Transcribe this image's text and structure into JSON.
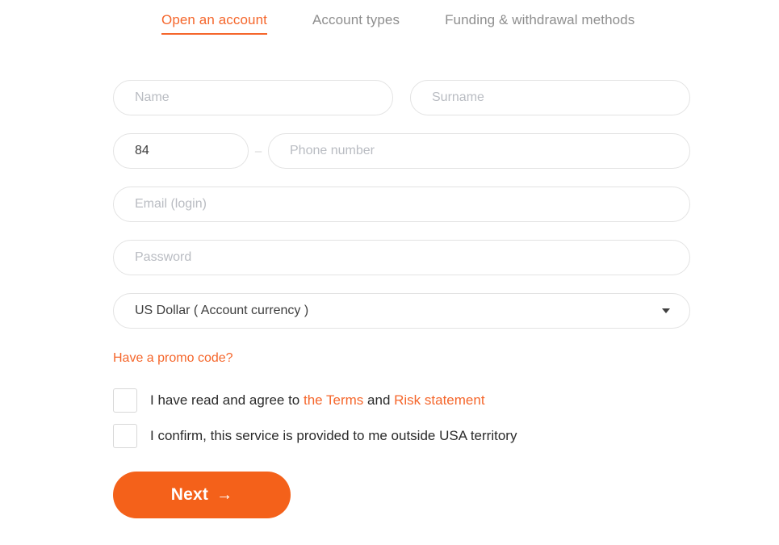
{
  "theme": {
    "accent": "#f5662b",
    "button_bg": "#f4611a",
    "placeholder": "#b9bcc2",
    "border": "#e3e3e3",
    "text": "#2b2b2b",
    "tab_inactive": "#8e8e8e"
  },
  "tabs": [
    {
      "label": "Open an account",
      "active": true
    },
    {
      "label": "Account types",
      "active": false
    },
    {
      "label": "Funding & withdrawal methods",
      "active": false
    }
  ],
  "form": {
    "name": {
      "placeholder": "Name",
      "value": ""
    },
    "surname": {
      "placeholder": "Surname",
      "value": ""
    },
    "country_code": {
      "placeholder": "",
      "value": "84"
    },
    "separator": "–",
    "phone": {
      "placeholder": "Phone number",
      "value": ""
    },
    "email": {
      "placeholder": "Email (login)",
      "value": ""
    },
    "password": {
      "placeholder": "Password",
      "value": ""
    },
    "currency": {
      "selected": "US Dollar ( Account currency )",
      "caret_icon": "chevron-down-icon"
    },
    "promo_link": "Have a promo code?"
  },
  "consents": [
    {
      "checked": false,
      "prefix": "I have read and agree to ",
      "link1": "the Terms",
      "middle": " and ",
      "link2": "Risk statement",
      "suffix": ""
    },
    {
      "checked": false,
      "prefix": "I confirm, this service is provided to me outside USA territory",
      "link1": "",
      "middle": "",
      "link2": "",
      "suffix": ""
    }
  ],
  "submit": {
    "label": "Next",
    "arrow": "→"
  }
}
